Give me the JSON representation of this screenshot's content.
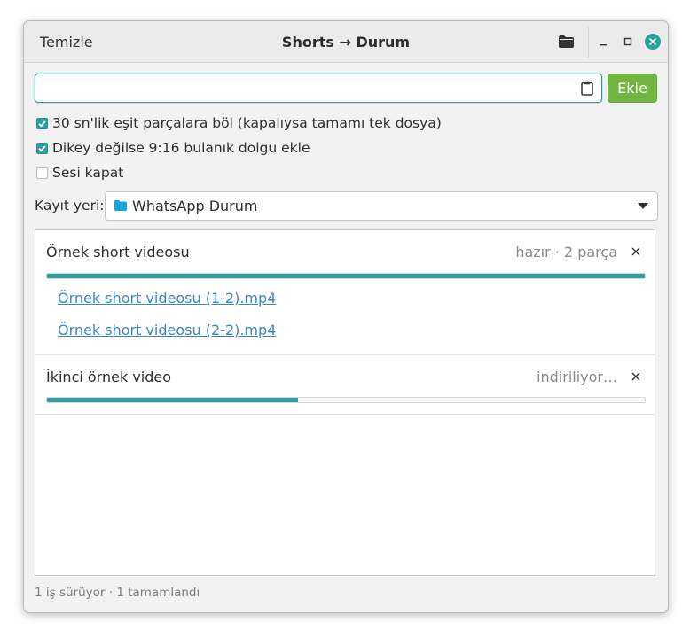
{
  "titlebar": {
    "clear_label": "Temizle",
    "title": "Shorts → Durum",
    "open_folder_icon": "folder-icon",
    "minimize_icon": "minimize-icon",
    "maximize_icon": "maximize-icon",
    "close_icon": "close-icon"
  },
  "url": {
    "value": "",
    "placeholder": "",
    "paste_icon": "clipboard-icon",
    "add_label": "Ekle"
  },
  "options": [
    {
      "label": "30 sn'lik eşit parçalara böl (kapalıysa tamamı tek dosya)",
      "checked": true
    },
    {
      "label": "Dikey değilse 9:16 bulanık dolgu ekle",
      "checked": true
    },
    {
      "label": "Sesi kapat",
      "checked": false
    }
  ],
  "save": {
    "label": "Kayıt yeri:",
    "value": "WhatsApp Durum",
    "icon": "folder-icon"
  },
  "jobs": [
    {
      "name": "Örnek short videosu",
      "status": "hazır · 2 parça",
      "progress": 1.0,
      "files": [
        "Örnek short videosu (1-2).mp4",
        "Örnek short videosu (2-2).mp4"
      ]
    },
    {
      "name": "İkinci örnek video",
      "status": "indiriliyor…",
      "progress": 0.42,
      "files": []
    }
  ],
  "remove_label": "×",
  "status_bar": "1 iş sürüyor · 1 tamamlandı",
  "colors": {
    "accent": "#2f9ea3",
    "add_button": "#72b542",
    "link": "#3c86c6"
  }
}
